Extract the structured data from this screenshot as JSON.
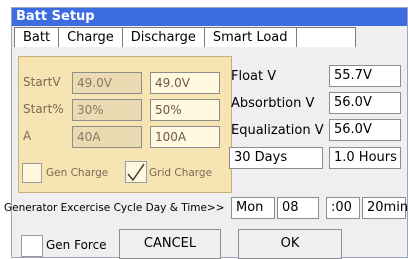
{
  "window": {
    "title": "Batt Setup"
  },
  "tabs": [
    "Batt",
    "Charge",
    "Discharge",
    "Smart Load"
  ],
  "charge_panel": {
    "startv_label": "StartV",
    "startpct_label": "Start%",
    "amps_label": "A",
    "gen_startv": "49.0V",
    "grid_startv": "49.0V",
    "gen_startpct": "30%",
    "grid_startpct": "50%",
    "gen_amps": "40A",
    "grid_amps": "100A",
    "gen_charge_label": "Gen Charge",
    "gen_charge_checked": false,
    "grid_charge_label": "Grid Charge",
    "grid_charge_checked": true
  },
  "right": {
    "float_label": "Float V",
    "float_value": "55.7V",
    "absorption_label": "Absorbtion V",
    "absorption_value": "56.0V",
    "equalization_label": "Equalization V",
    "equalization_value": "56.0V",
    "eq_days": "30 Days",
    "eq_hours": "1.0 Hours"
  },
  "generator": {
    "label": "Generator Excercise Cycle Day & Time>>",
    "day": "Mon",
    "hour": "08",
    "minute": ":00",
    "duration": "20min"
  },
  "footer": {
    "gen_force_label": "Gen Force",
    "gen_force_checked": false,
    "cancel_label": "CANCEL",
    "ok_label": "OK"
  }
}
